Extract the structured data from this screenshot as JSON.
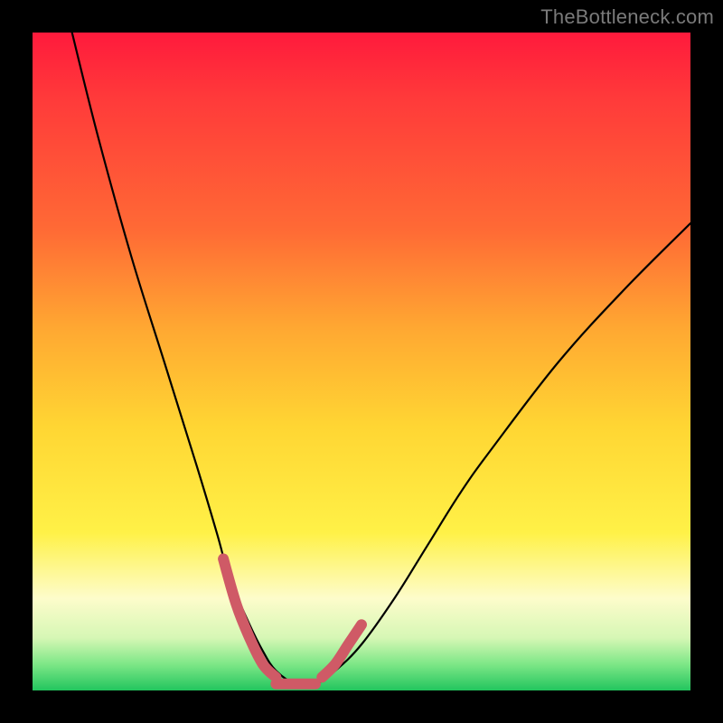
{
  "watermark": "TheBottleneck.com",
  "colors": {
    "curve": "#000000",
    "accent": "#cf5a66",
    "background_top": "#ff1a3c",
    "background_bottom": "#22c55e",
    "frame": "#000000"
  },
  "chart_data": {
    "type": "line",
    "title": "",
    "xlabel": "",
    "ylabel": "",
    "xlim": [
      0,
      100
    ],
    "ylim": [
      0,
      100
    ],
    "grid": false,
    "legend": false,
    "series": [
      {
        "name": "bottleneck-curve",
        "x": [
          6,
          10,
          15,
          20,
          25,
          28,
          30,
          33,
          35,
          37,
          40,
          43,
          46,
          50,
          55,
          60,
          65,
          70,
          80,
          90,
          100
        ],
        "y": [
          100,
          84,
          66,
          50,
          34,
          24,
          17,
          10,
          6,
          3,
          1,
          1,
          3,
          7,
          14,
          22,
          30,
          37,
          50,
          61,
          71
        ]
      },
      {
        "name": "accent-left",
        "x": [
          29,
          31,
          33,
          35,
          37
        ],
        "y": [
          20,
          13,
          8,
          4,
          2
        ]
      },
      {
        "name": "accent-bottom",
        "x": [
          37,
          40,
          43
        ],
        "y": [
          1,
          1,
          1
        ]
      },
      {
        "name": "accent-right",
        "x": [
          44,
          46,
          48,
          50
        ],
        "y": [
          2,
          4,
          7,
          10
        ]
      }
    ],
    "annotations": []
  }
}
